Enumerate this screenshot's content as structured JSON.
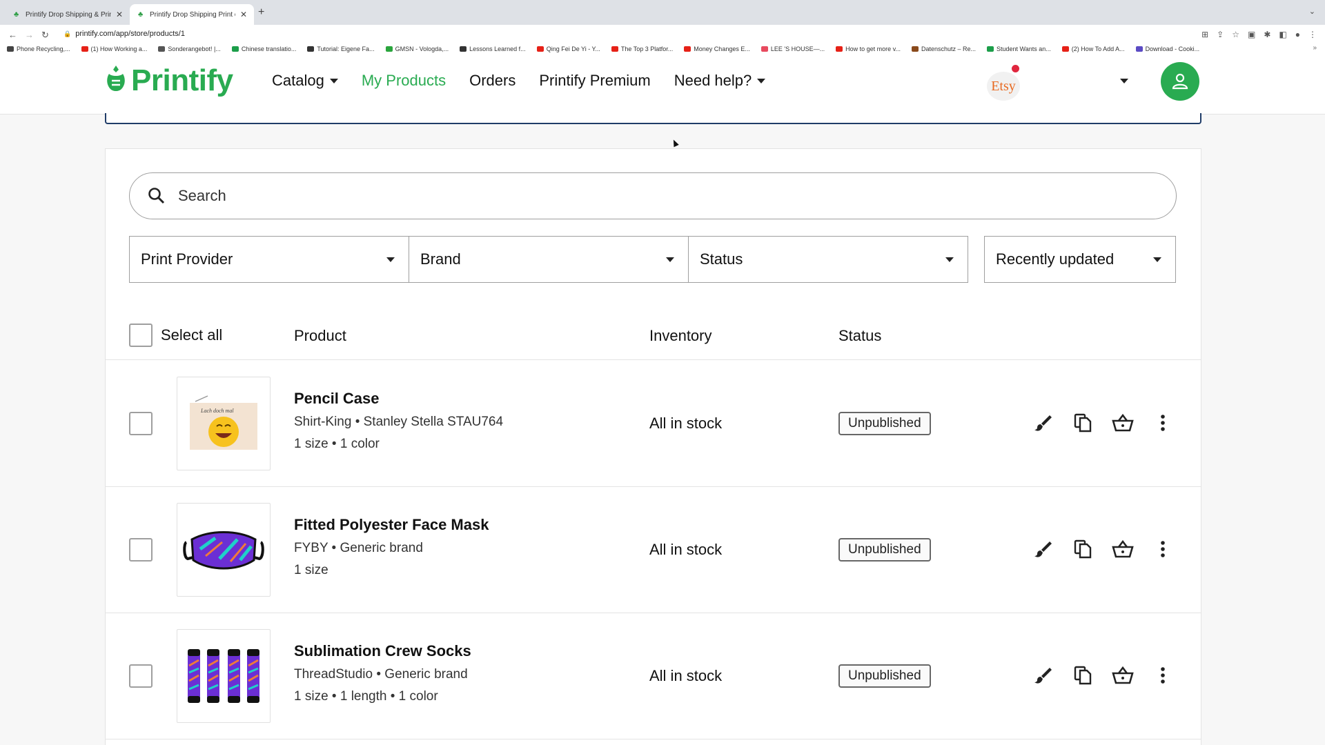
{
  "browser": {
    "tabs": [
      {
        "title": "Printify Drop Shipping & Printi"
      },
      {
        "title": "Printify Drop Shipping Print on"
      }
    ],
    "new_tab": "+",
    "url": "printify.com/app/store/products/1",
    "bookmarks": [
      {
        "label": "Phone Recycling,...",
        "color": "#444"
      },
      {
        "label": "(1) How Working a...",
        "color": "#e62117"
      },
      {
        "label": "Sonderangebot! |...",
        "color": "#555"
      },
      {
        "label": "Chinese translatio...",
        "color": "#1c9e4a"
      },
      {
        "label": "Tutorial: Eigene Fa...",
        "color": "#333"
      },
      {
        "label": "GMSN - Vologda,...",
        "color": "#2aa53d"
      },
      {
        "label": "Lessons Learned f...",
        "color": "#333"
      },
      {
        "label": "Qing Fei De Yi - Y...",
        "color": "#e62117"
      },
      {
        "label": "The Top 3 Platfor...",
        "color": "#e62117"
      },
      {
        "label": "Money Changes E...",
        "color": "#e62117"
      },
      {
        "label": "LEE 'S HOUSE—...",
        "color": "#e84a5f"
      },
      {
        "label": "How to get more v...",
        "color": "#e62117"
      },
      {
        "label": "Datenschutz – Re...",
        "color": "#8a4a1c"
      },
      {
        "label": "Student Wants an...",
        "color": "#1c9e4a"
      },
      {
        "label": "(2) How To Add A...",
        "color": "#e62117"
      },
      {
        "label": "Download - Cooki...",
        "color": "#5b4bc4"
      }
    ],
    "bookmarks_more": "»"
  },
  "header": {
    "logo_text": "Printify",
    "nav": [
      {
        "label": "Catalog",
        "dropdown": true
      },
      {
        "label": "My Products",
        "active": true
      },
      {
        "label": "Orders"
      },
      {
        "label": "Printify Premium"
      },
      {
        "label": "Need help?",
        "dropdown": true
      }
    ],
    "store": "Etsy",
    "colors": {
      "brand": "#29ab51",
      "notification": "#e0263e"
    }
  },
  "search": {
    "placeholder": "Search"
  },
  "filters": {
    "print_provider": "Print Provider",
    "brand": "Brand",
    "status": "Status",
    "sort": "Recently updated"
  },
  "table": {
    "select_all": "Select all",
    "columns": {
      "product": "Product",
      "inventory": "Inventory",
      "status": "Status"
    },
    "rows": [
      {
        "title": "Pencil Case",
        "provider_line": "Shirt-King • Stanley Stella STAU764",
        "variants_line": "1 size • 1 color",
        "inventory": "All in stock",
        "status": "Unpublished",
        "thumb_text": "Lach doch mal"
      },
      {
        "title": "Fitted Polyester Face Mask",
        "provider_line": "FYBY • Generic brand",
        "variants_line": "1 size",
        "inventory": "All in stock",
        "status": "Unpublished"
      },
      {
        "title": "Sublimation Crew Socks",
        "provider_line": "ThreadStudio • Generic brand",
        "variants_line": "1 size • 1 length • 1 color",
        "inventory": "All in stock",
        "status": "Unpublished"
      }
    ]
  }
}
